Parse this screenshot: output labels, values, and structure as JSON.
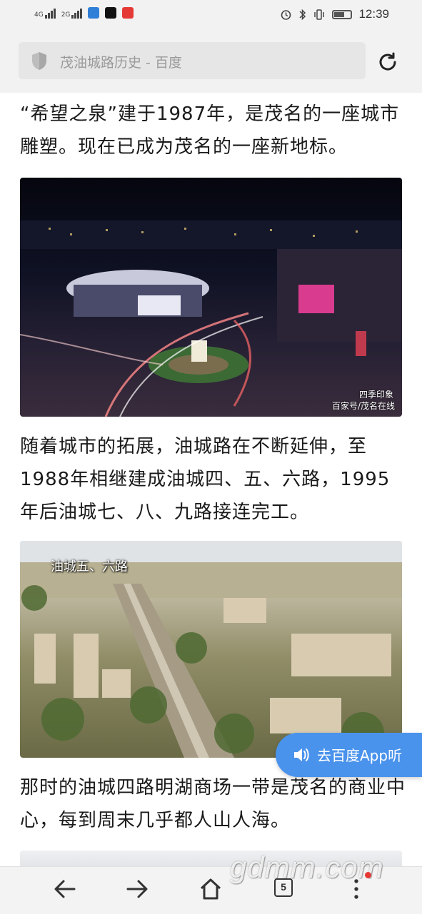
{
  "status_bar": {
    "network1": "4G",
    "network2": "2G",
    "time": "12:39",
    "battery_level": 0.65
  },
  "address_bar": {
    "url_text": "茂油城路历史 - 百度"
  },
  "content": {
    "paragraph1": "“希望之泉”建于1987年，是茂名的一座城市雕塑。现在已成为茂名的一座新地标。",
    "image1": {
      "logo_text": "四季印象",
      "credit": "百家号/茂名在线"
    },
    "paragraph2": "随着城市的拓展，油城路在不断延伸，至1988年相继建成油城四、五、六路，1995年后油城七、八、九路接连完工。",
    "image2": {
      "caption": "油城五、六路"
    },
    "paragraph3": "那时的油城四路明湖商场一带是茂名的商业中心，每到周末几乎都人山人海。"
  },
  "listen_button": {
    "label": "去百度App听"
  },
  "bottom_nav": {
    "tab_count": "5"
  },
  "watermark": "gdmm.com",
  "colors": {
    "accent": "#4a93ec",
    "watermark_dot": "#e53935"
  }
}
